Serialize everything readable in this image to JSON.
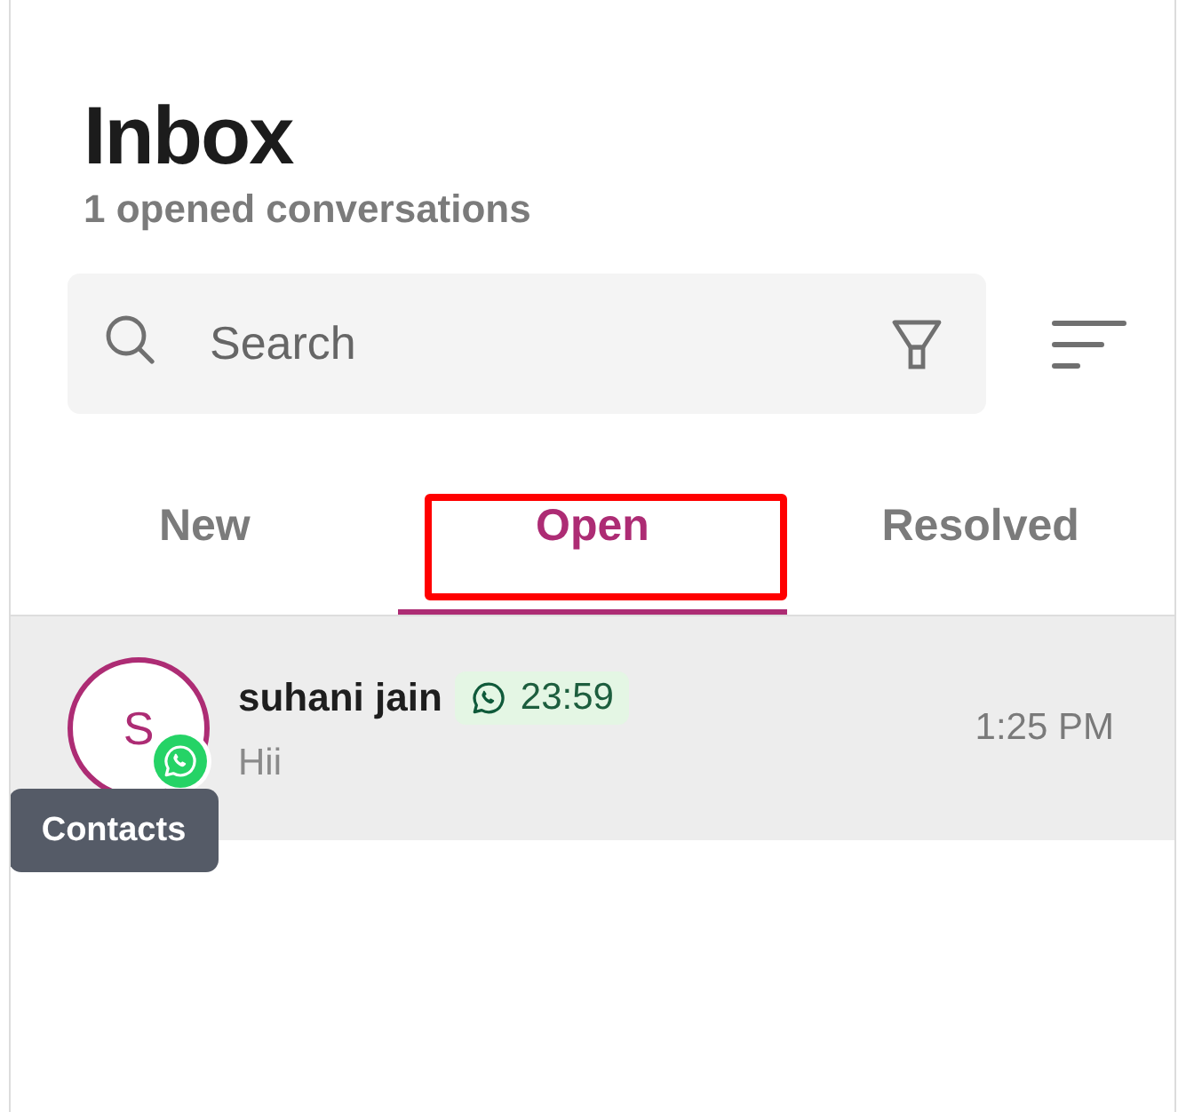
{
  "header": {
    "title": "Inbox",
    "subtitle": "1 opened conversations"
  },
  "search": {
    "placeholder": "Search"
  },
  "tabs": [
    {
      "label": "New",
      "selected": false,
      "highlighted": false
    },
    {
      "label": "Open",
      "selected": true,
      "highlighted": true
    },
    {
      "label": "Resolved",
      "selected": false,
      "highlighted": false
    }
  ],
  "conversations": [
    {
      "avatar_initial": "S",
      "name": "suhani jain",
      "timer": "23:59",
      "preview": "Hii",
      "time": "1:25 PM",
      "selected": true
    }
  ],
  "tooltip": {
    "text": "Contacts"
  }
}
